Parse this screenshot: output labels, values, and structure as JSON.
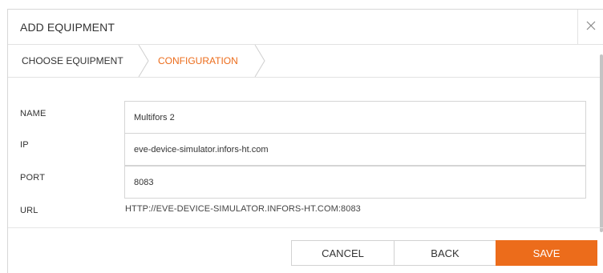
{
  "dialog": {
    "title": "ADD EQUIPMENT",
    "close_icon": "close-icon"
  },
  "steps": [
    {
      "label": "CHOOSE EQUIPMENT",
      "state": "done"
    },
    {
      "label": "CONFIGURATION",
      "state": "active"
    }
  ],
  "form": {
    "name_label": "NAME",
    "name_value": "Multifors 2",
    "ip_label": "IP",
    "ip_value": "eve-device-simulator.infors-ht.com",
    "port_label": "PORT",
    "port_value": "8083",
    "url_label": "URL",
    "url_value": "HTTP://EVE-DEVICE-SIMULATOR.INFORS-HT.COM:8083"
  },
  "buttons": {
    "cancel": "CANCEL",
    "back": "BACK",
    "save": "SAVE"
  },
  "colors": {
    "accent": "#ec6c1b",
    "border": "#d5d5d5",
    "text": "#333333"
  }
}
